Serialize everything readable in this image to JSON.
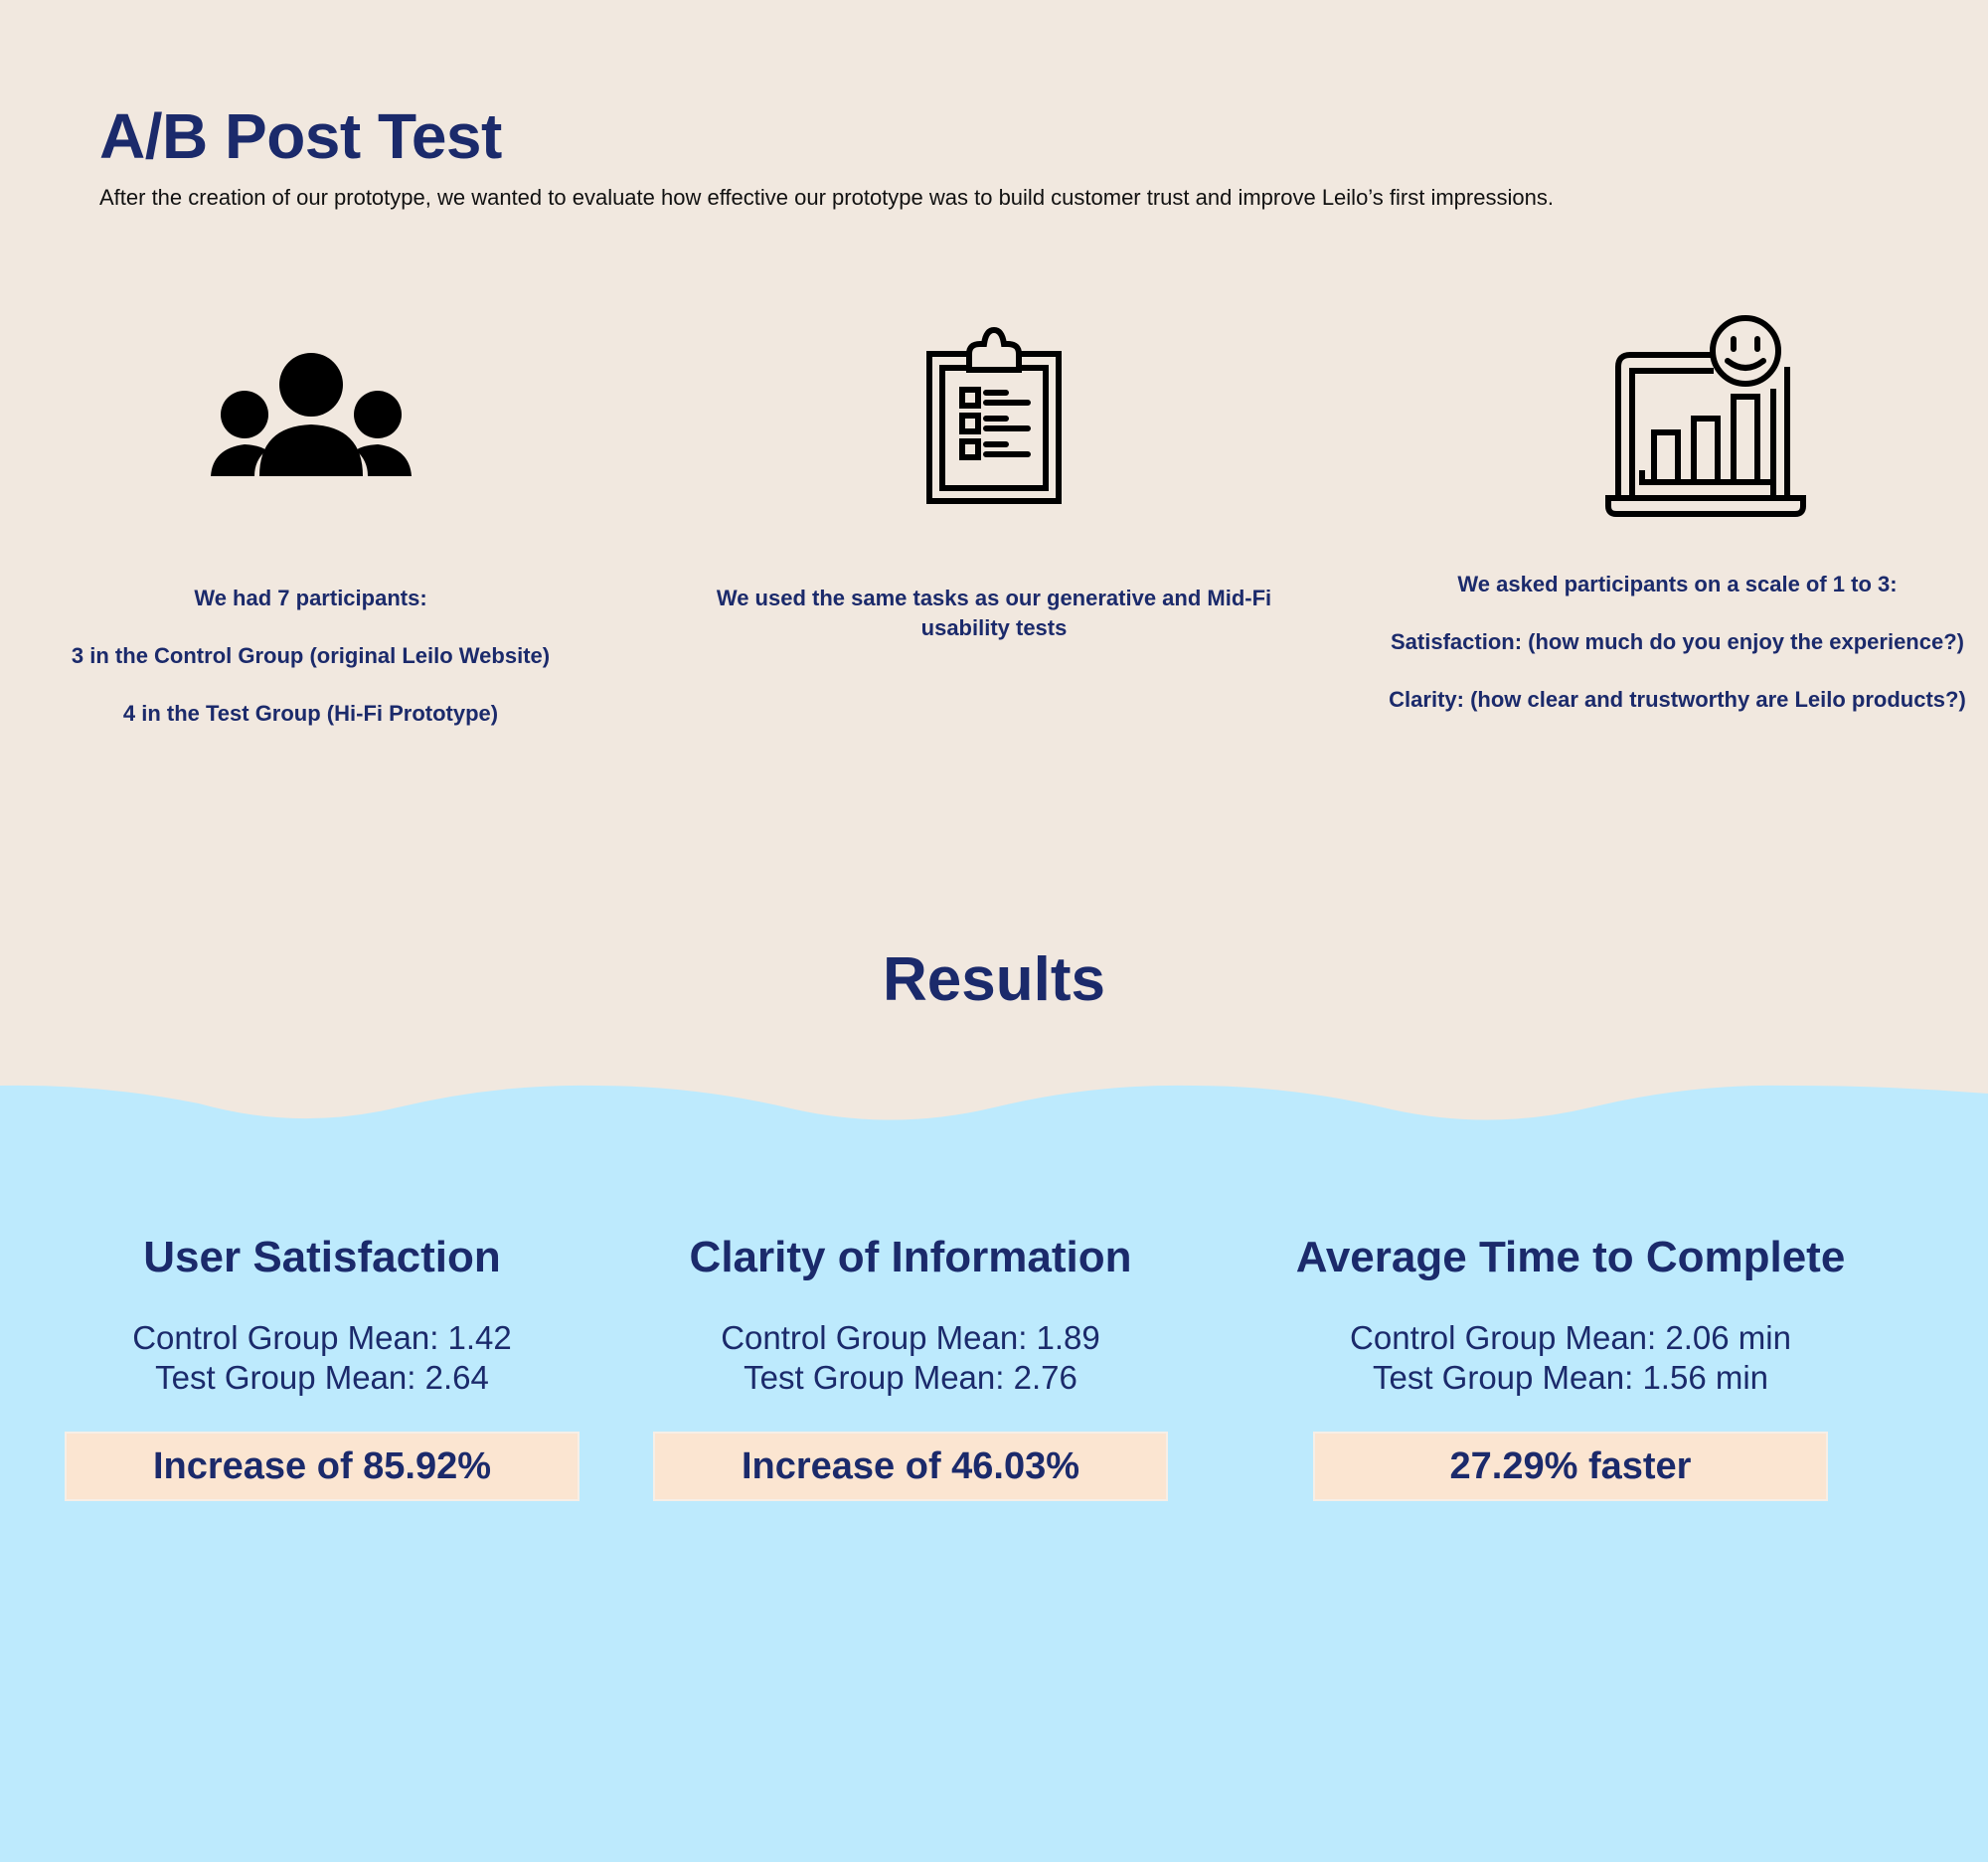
{
  "header": {
    "title": "A/B Post Test",
    "intro": "After the creation of our prototype, we wanted to evaluate how effective our prototype was to build customer trust and improve Leilo’s first impressions."
  },
  "columns": [
    {
      "icon": "people-group-icon",
      "lines": [
        "We had 7 participants:",
        "3 in the Control Group (original Leilo Website)",
        "4 in the Test Group (Hi-Fi Prototype)"
      ]
    },
    {
      "icon": "clipboard-checklist-icon",
      "lines": [
        "We used the same tasks as our generative and Mid-Fi usability tests"
      ]
    },
    {
      "icon": "laptop-chart-smiley-icon",
      "lines": [
        "We asked participants on a scale of 1 to 3:",
        "Satisfaction: (how much do you enjoy the experience?)",
        "Clarity: (how clear and trustworthy are Leilo products?)"
      ]
    }
  ],
  "results": {
    "title": "Results",
    "metrics": [
      {
        "title": "User Satisfaction",
        "control": "Control Group Mean: 1.42",
        "test": "Test Group Mean: 2.64",
        "highlight": "Increase of 85.92%"
      },
      {
        "title": "Clarity of Information",
        "control": "Control Group Mean: 1.89",
        "test": "Test Group Mean: 2.76",
        "highlight": "Increase of 46.03%"
      },
      {
        "title": "Average Time to Complete",
        "control": "Control Group Mean: 2.06 min",
        "test": "Test Group Mean: 1.56 min",
        "highlight": "27.29% faster"
      }
    ]
  },
  "colors": {
    "navy": "#1b2a6b",
    "beige": "#f1e8df",
    "sky": "#bdeafd",
    "peach": "#fbe5d1"
  }
}
